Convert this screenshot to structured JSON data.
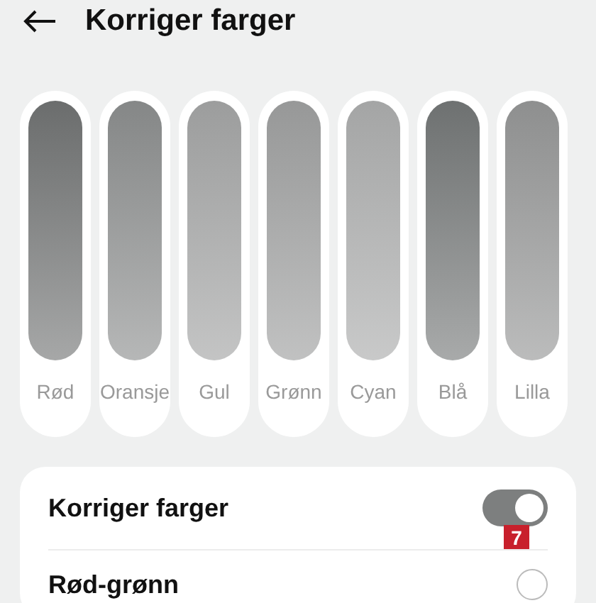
{
  "header": {
    "title": "Korriger farger"
  },
  "swatches": [
    {
      "label": "Rød",
      "color": "#6b6d6d"
    },
    {
      "label": "Oransje",
      "color": "#858787"
    },
    {
      "label": "Gul",
      "color": "#9c9d9d"
    },
    {
      "label": "Grønn",
      "color": "#979898"
    },
    {
      "label": "Cyan",
      "color": "#a4a5a5"
    },
    {
      "label": "Blå",
      "color": "#6e7171"
    },
    {
      "label": "Lilla",
      "color": "#8e8f8f"
    }
  ],
  "settings": [
    {
      "kind": "toggle",
      "label": "Korriger farger",
      "on": true,
      "badge": "7"
    },
    {
      "kind": "radio",
      "label": "Rød-grønn",
      "selected": false
    }
  ]
}
